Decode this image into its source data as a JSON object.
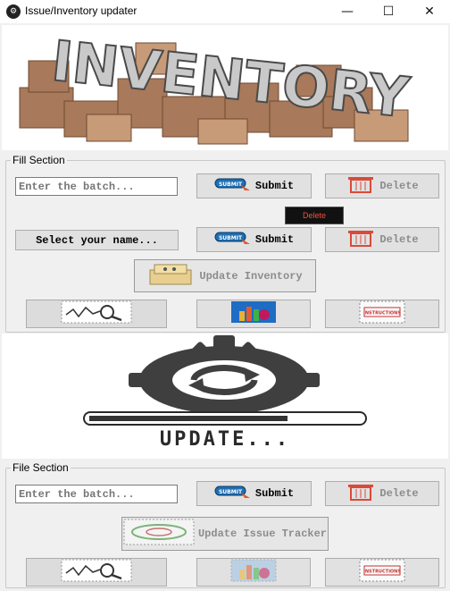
{
  "window": {
    "title": "Issue/Inventory updater",
    "minimize": "—",
    "maximize": "☐",
    "close": "✕"
  },
  "banner": {
    "text": "INVENTORY"
  },
  "fill_section": {
    "label": "Fill Section",
    "batch_placeholder": "Enter the batch...",
    "batch_submit": "Submit",
    "batch_delete": "Delete",
    "small_delete": "Delete",
    "name_select": "Select your name...",
    "name_submit": "Submit",
    "name_delete": "Delete",
    "update_inventory": "Update Inventory"
  },
  "update_graphic": {
    "text": "UPDATE...",
    "progress": 0.73
  },
  "file_section": {
    "label": "File Section",
    "batch_placeholder": "Enter the batch...",
    "batch_submit": "Submit",
    "batch_delete": "Delete",
    "update_issue_tracker": "Update Issue Tracker"
  },
  "instructions_label": "INSTRUCTIONS",
  "submit_badge": "SUBMIT",
  "icons": [
    "search-chart-icon",
    "bar-chart-icon",
    "instructions-icon",
    "trash-icon",
    "submit-hand-icon",
    "gear-refresh-icon"
  ],
  "colors": {
    "delete_red": "#d94a3a",
    "progress_fill": "#333333"
  }
}
